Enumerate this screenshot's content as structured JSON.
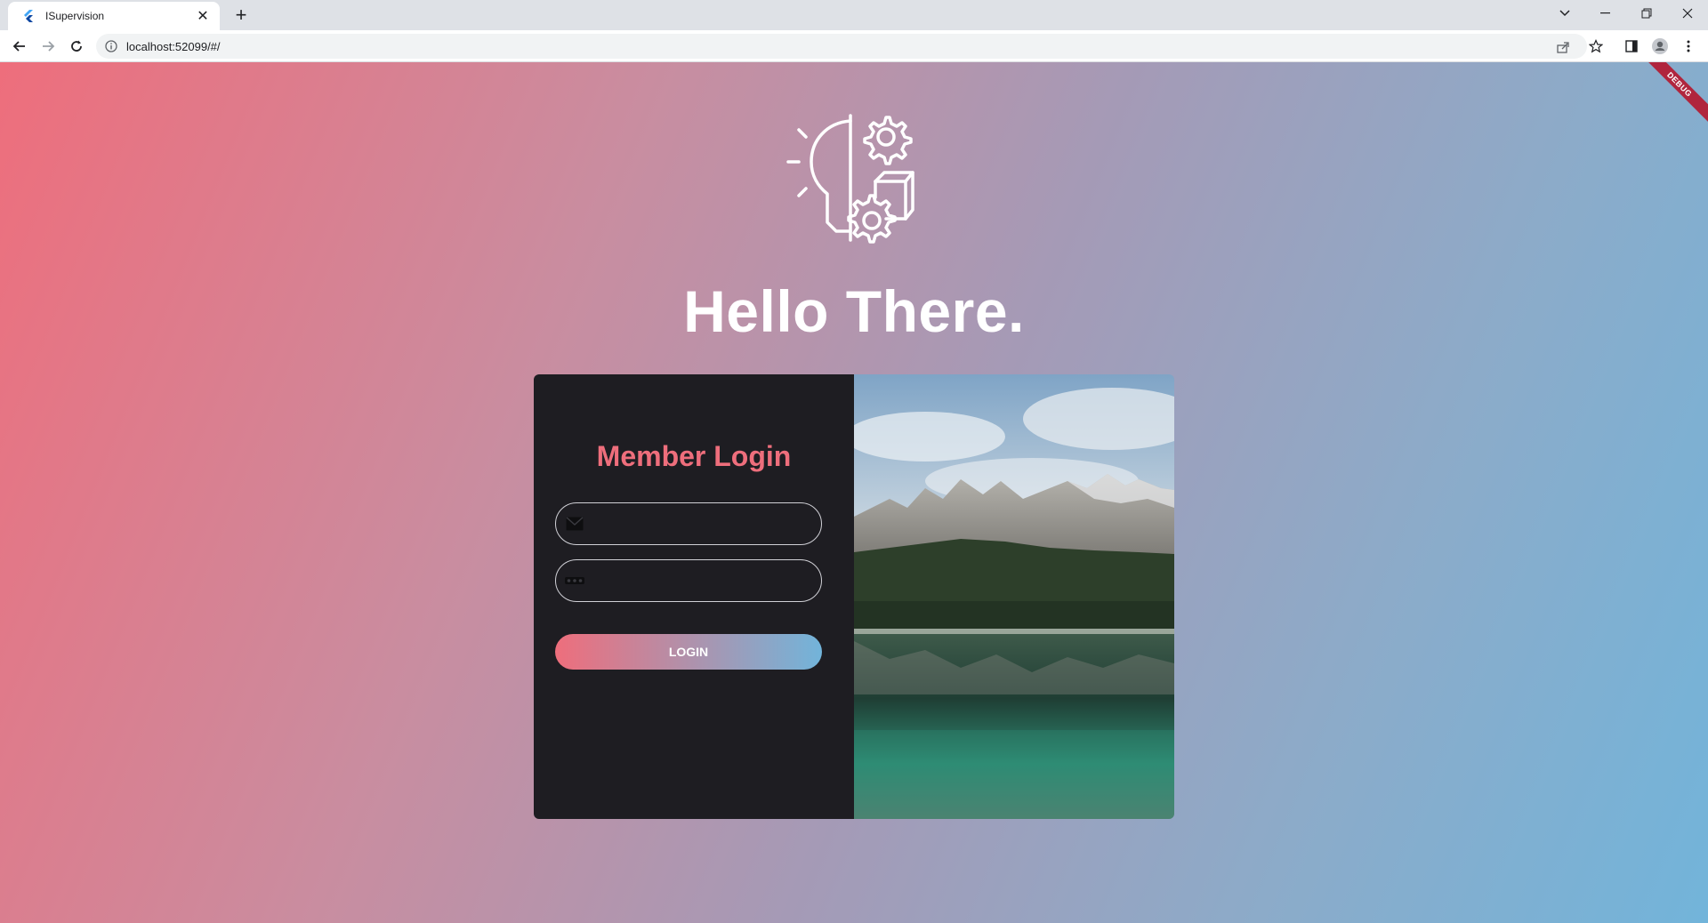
{
  "browser": {
    "tab_title": "ISupervision",
    "url": "localhost:52099/#/"
  },
  "app": {
    "debug_banner": "DEBUG",
    "heading": "Hello There.",
    "login": {
      "title": "Member Login",
      "email_placeholder": "",
      "password_placeholder": "",
      "button_label": "LOGIN"
    },
    "colors": {
      "accent_pink": "#ee6e7c",
      "accent_blue": "#72b4da",
      "panel_dark": "#1e1d22"
    }
  }
}
